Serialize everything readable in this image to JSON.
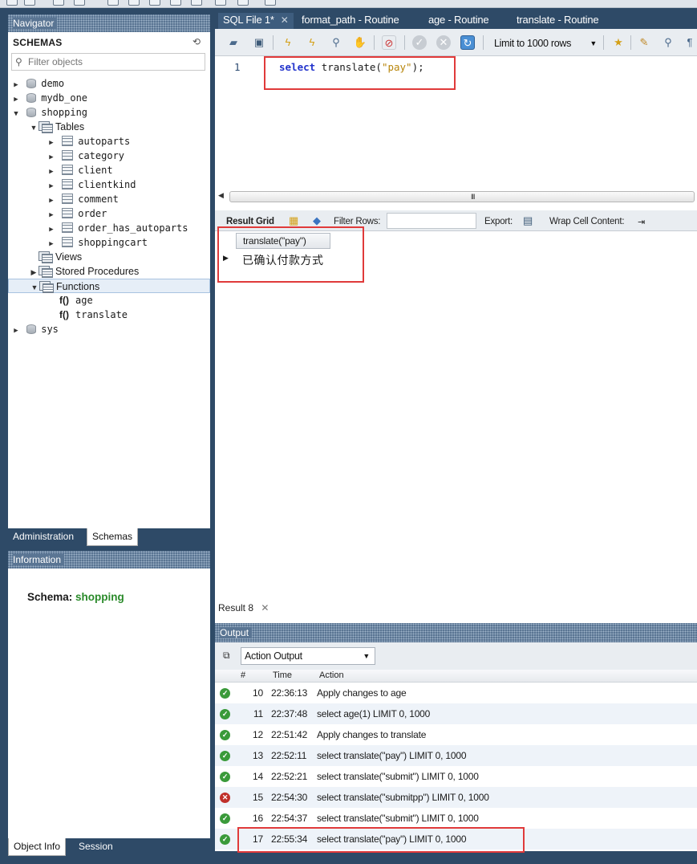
{
  "navigator": {
    "title": "Navigator",
    "schemas_label": "SCHEMAS",
    "filter_placeholder": "Filter objects",
    "tree": {
      "demo": "demo",
      "mydb_one": "mydb_one",
      "shopping": "shopping",
      "tables_folder": "Tables",
      "tables": [
        "autoparts",
        "category",
        "client",
        "clientkind",
        "comment",
        "order",
        "order_has_autoparts",
        "shoppingcart"
      ],
      "views": "Views",
      "stored_procedures": "Stored Procedures",
      "functions": "Functions",
      "function_items": [
        "age",
        "translate"
      ],
      "function_prefix": "f()",
      "sys": "sys"
    }
  },
  "left_tabs": {
    "administration": "Administration",
    "schemas": "Schemas"
  },
  "information": {
    "title": "Information",
    "schema_label": "Schema:",
    "schema_value": "shopping"
  },
  "object_tabs": {
    "object_info": "Object Info",
    "session": "Session"
  },
  "file_tabs": [
    {
      "label": "SQL File 1*"
    },
    {
      "label": "format_path - Routine"
    },
    {
      "label": "age - Routine"
    },
    {
      "label": "translate - Routine"
    }
  ],
  "toolbar": {
    "limit_label": "Limit to 1000 rows"
  },
  "editor": {
    "line_number": "1",
    "keyword": "select",
    "func": "translate(",
    "arg": "\"pay\"",
    "tail": ");"
  },
  "result_toolbar": {
    "result_grid": "Result Grid",
    "filter_rows": "Filter Rows:",
    "export": "Export:",
    "wrap": "Wrap Cell Content:"
  },
  "result_grid": {
    "column": "translate(\"pay\")",
    "value": "已确认付款方式"
  },
  "result_tab": "Result 8",
  "output": {
    "title": "Output",
    "mode": "Action Output",
    "columns": {
      "num": "#",
      "time": "Time",
      "action": "Action"
    },
    "rows": [
      {
        "status": "ok",
        "num": "10",
        "time": "22:36:13",
        "action": "Apply changes to age"
      },
      {
        "status": "ok",
        "num": "11",
        "time": "22:37:48",
        "action": "select age(1) LIMIT 0, 1000"
      },
      {
        "status": "ok",
        "num": "12",
        "time": "22:51:42",
        "action": "Apply changes to translate"
      },
      {
        "status": "ok",
        "num": "13",
        "time": "22:52:11",
        "action": "select translate(\"pay\") LIMIT 0, 1000"
      },
      {
        "status": "ok",
        "num": "14",
        "time": "22:52:21",
        "action": "select translate(\"submit\") LIMIT 0, 1000"
      },
      {
        "status": "error",
        "num": "15",
        "time": "22:54:30",
        "action": "select translate(\"submitpp\") LIMIT 0, 1000"
      },
      {
        "status": "ok",
        "num": "16",
        "time": "22:54:37",
        "action": "select translate(\"submit\") LIMIT 0, 1000"
      },
      {
        "status": "ok",
        "num": "17",
        "time": "22:55:34",
        "action": "select translate(\"pay\") LIMIT 0, 1000"
      }
    ]
  },
  "colors": {
    "panel_bg": "#2e4a67",
    "success": "#3a9a3a",
    "error": "#c0302a",
    "highlight": "#e03a3a",
    "schema_value": "#2a8a2a"
  }
}
